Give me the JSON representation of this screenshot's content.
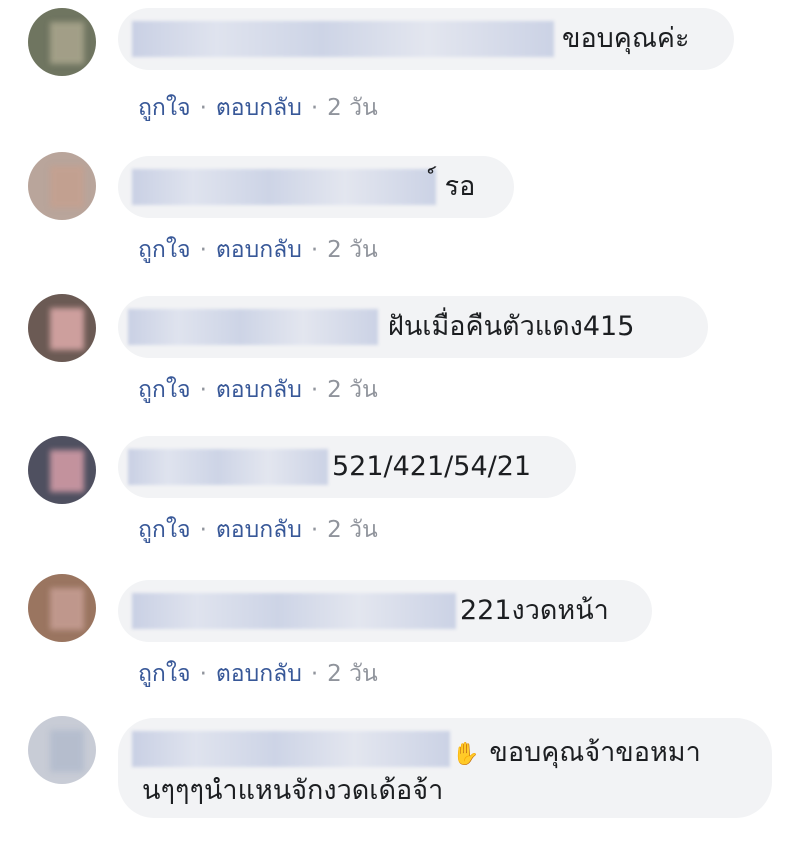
{
  "actions": {
    "like": "ถูกใจ",
    "reply": "ตอบกลับ",
    "separator": "·",
    "time": "2 วัน"
  },
  "comments": [
    {
      "text": "ขอบคุณค่ะ"
    },
    {
      "text": "์ รอ"
    },
    {
      "text": "ฝันเมื่อคืนตัวแดง415"
    },
    {
      "text": "521/421/54/21"
    },
    {
      "text": "221งวดหน้า"
    },
    {
      "text_line1": "ขอบคุณจ้าขอหมา",
      "text_line2": "นๆๆๆนำแหนจักงวดเด้อจ้า",
      "emoji_icon": "waving-hand-icon"
    }
  ],
  "colors": {
    "bubble": "#f2f3f5",
    "link": "#385898",
    "meta": "#90949c"
  }
}
